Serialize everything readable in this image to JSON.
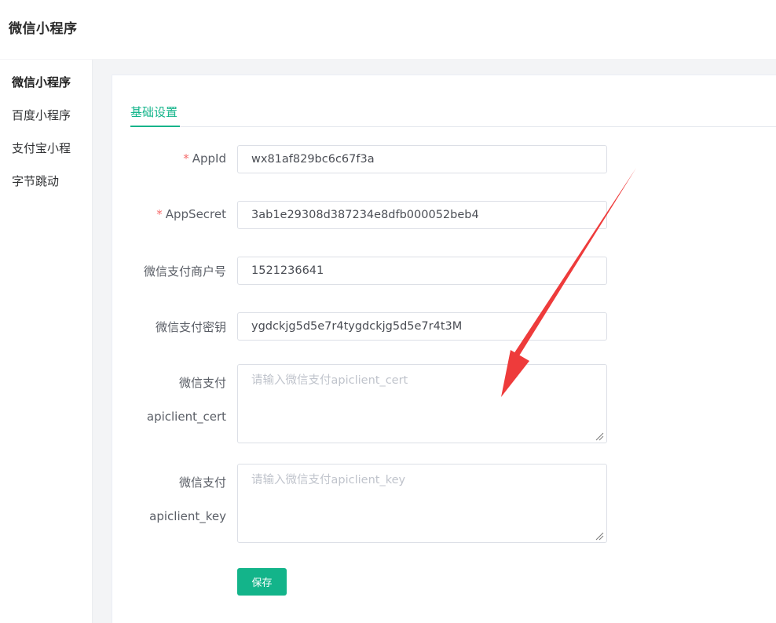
{
  "header": {
    "title": "微信小程序"
  },
  "sidebar": {
    "items": [
      {
        "label": "微信小程序",
        "active": true
      },
      {
        "label": "百度小程序",
        "active": false
      },
      {
        "label": "支付宝小程",
        "active": false
      },
      {
        "label": "字节跳动",
        "active": false
      }
    ]
  },
  "tabs": [
    {
      "label": "基础设置",
      "active": true
    }
  ],
  "form": {
    "appid": {
      "label": "AppId",
      "required": true,
      "value": "wx81af829bc6c67f3a"
    },
    "appsecret": {
      "label": "AppSecret",
      "required": true,
      "value": "3ab1e29308d387234e8dfb000052beb4"
    },
    "mch_id": {
      "label": "微信支付商户号",
      "value": "1521236641"
    },
    "pay_key": {
      "label": "微信支付密钥",
      "value": "ygdckjg5d5e7r4tygdckjg5d5e7r4t3M"
    },
    "cert": {
      "label_line1": "微信支付",
      "label_line2": "apiclient_cert",
      "value": "",
      "placeholder": "请输入微信支付apiclient_cert"
    },
    "key": {
      "label_line1": "微信支付",
      "label_line2": "apiclient_key",
      "value": "",
      "placeholder": "请输入微信支付apiclient_key"
    },
    "save_label": "保存"
  },
  "colors": {
    "accent": "#13b48a",
    "required": "#f56c6c",
    "annotation_arrow": "#ee3b3b"
  },
  "icons": {
    "annotation": "red-arrow-icon",
    "resize": "resize-handle-icon"
  }
}
